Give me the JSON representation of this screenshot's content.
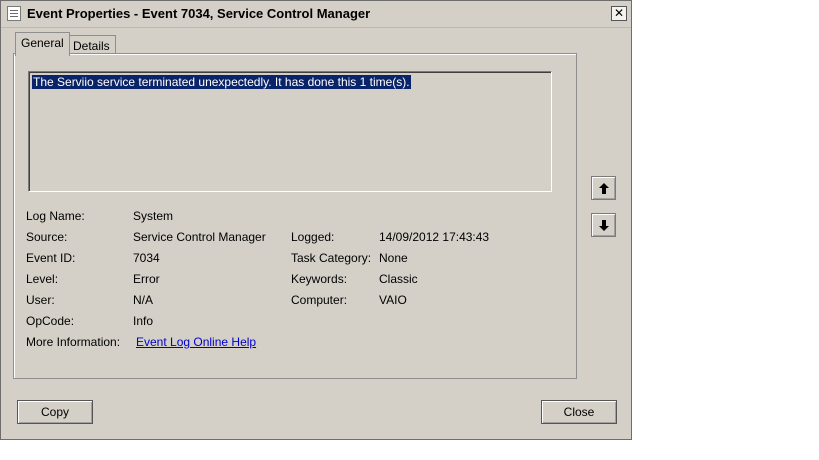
{
  "window": {
    "title": "Event Properties - Event 7034, Service Control Manager",
    "close_glyph": "✕"
  },
  "tabs": [
    {
      "label": "General",
      "active": true
    },
    {
      "label": "Details",
      "active": false
    }
  ],
  "description": "The Serviio service terminated unexpectedly.  It has done this 1 time(s).",
  "fields": {
    "log_name": {
      "label": "Log Name:",
      "value": "System"
    },
    "source": {
      "label": "Source:",
      "value": "Service Control Manager"
    },
    "event_id": {
      "label": "Event ID:",
      "value": "7034"
    },
    "level": {
      "label": "Level:",
      "value": "Error"
    },
    "user": {
      "label": "User:",
      "value": "N/A"
    },
    "opcode": {
      "label": "OpCode:",
      "value": "Info"
    },
    "more_info": {
      "label": "More Information:",
      "value": "Event Log Online Help"
    },
    "logged": {
      "label": "Logged:",
      "value": "14/09/2012 17:43:43"
    },
    "task_category": {
      "label": "Task Category:",
      "value": "None"
    },
    "keywords": {
      "label": "Keywords:",
      "value": "Classic"
    },
    "computer": {
      "label": "Computer:",
      "value": "VAIO"
    }
  },
  "buttons": {
    "copy": "Copy",
    "close": "Close"
  },
  "icons": {
    "title": "event-viewer-icon",
    "previous": "arrow-up-icon",
    "next": "arrow-down-icon"
  }
}
